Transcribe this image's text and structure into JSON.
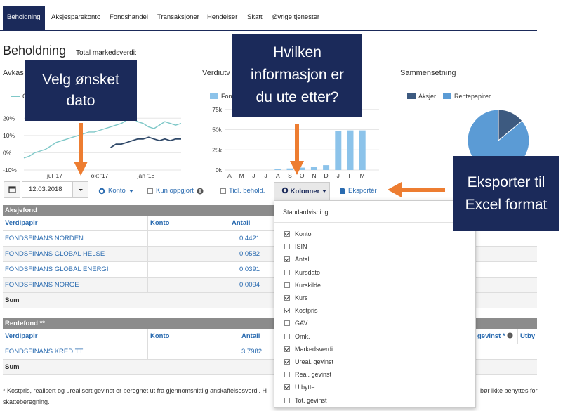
{
  "nav": {
    "tabs": [
      "Beholdning",
      "Aksjesparekonto",
      "Fondshandel",
      "Transaksjoner",
      "Hendelser",
      "Skatt",
      "Øvrige tjenester"
    ]
  },
  "page": {
    "title": "Beholdning",
    "subtitle": "Total markedsverdi:"
  },
  "sections": {
    "avkastning": "Avkas",
    "verdiutvikling": "Verdiutv",
    "sammensetning": "Sammensetning"
  },
  "legends": {
    "line_chart_partial": "O",
    "bar_chart_partial": "Fond",
    "pie_aksjer": "Aksjer",
    "pie_rente": "Rentepapirer"
  },
  "chart_data": [
    {
      "type": "line",
      "y_ticks": [
        "20%",
        "10%",
        "0%",
        "-10%"
      ],
      "x_ticks": [
        "jul '17",
        "okt '17",
        "jan '18"
      ],
      "ylim": [
        -10,
        25
      ],
      "series": [
        {
          "color": "#7fc8c8",
          "values": [
            -3,
            -2,
            0,
            1,
            2,
            4,
            6,
            7,
            8,
            9,
            10,
            11,
            12,
            12,
            13,
            14,
            15,
            16,
            17,
            19,
            20,
            18,
            17,
            15,
            14,
            16,
            18,
            17,
            16,
            17
          ]
        },
        {
          "color": "#2f4868",
          "values": [
            null,
            null,
            null,
            null,
            null,
            null,
            null,
            null,
            null,
            null,
            null,
            null,
            null,
            null,
            null,
            null,
            3,
            5,
            5,
            6,
            7,
            8,
            8,
            9,
            8,
            7,
            8,
            7,
            8,
            8
          ]
        }
      ]
    },
    {
      "type": "bar",
      "categories": [
        "A",
        "M",
        "J",
        "J",
        "A",
        "S",
        "O",
        "N",
        "D",
        "J",
        "F",
        "M"
      ],
      "values": [
        0,
        0,
        0,
        0,
        1,
        2,
        3,
        4,
        6,
        48,
        49,
        49
      ],
      "y_ticks": [
        "75k",
        "50k",
        "25k",
        "0k"
      ],
      "ylim": [
        0,
        80
      ],
      "color": "#8cc3ea"
    },
    {
      "type": "pie",
      "slices": [
        {
          "label": "Aksjer",
          "value": 14,
          "color": "#3d5a80"
        },
        {
          "label": "Rentepapirer",
          "value": 86,
          "color": "#5b9bd5"
        }
      ]
    }
  ],
  "toolbar": {
    "date_value": "12.03.2018",
    "konto": "Konto",
    "kun_oppgjort": "Kun oppgjort",
    "tidl_behold": "Tidl. behold.",
    "kolonner": "Kolonner",
    "eksporter": "Eksportér"
  },
  "table_aksjefond": {
    "title": "Aksjefond",
    "columns": [
      "Verdipapir",
      "Konto",
      "Antall"
    ],
    "rows": [
      {
        "name": "FONDSFINANS NORDEN",
        "antall": "0,4421"
      },
      {
        "name": "FONDSFINANS GLOBAL HELSE",
        "antall": "0,0582"
      },
      {
        "name": "FONDSFINANS GLOBAL ENERGI",
        "antall": "0,0391"
      },
      {
        "name": "FONDSFINANS NORGE",
        "antall": "0,0094"
      }
    ],
    "sum": "Sum"
  },
  "table_rentefond": {
    "title": "Rentefond **",
    "columns": [
      "Verdipapir",
      "Konto",
      "Antall"
    ],
    "extra_cols": [
      "gevinst *",
      "Utby"
    ],
    "rows": [
      {
        "name": "FONDSFINANS KREDITT",
        "antall": "3,7982"
      }
    ],
    "sum": "Sum"
  },
  "dropdown": {
    "header": "Standardvisning",
    "items": [
      {
        "label": "Konto",
        "checked": true
      },
      {
        "label": "ISIN",
        "checked": false
      },
      {
        "label": "Antall",
        "checked": true
      },
      {
        "label": "Kursdato",
        "checked": false
      },
      {
        "label": "Kurskilde",
        "checked": false
      },
      {
        "label": "Kurs",
        "checked": true
      },
      {
        "label": "Kostpris",
        "checked": true
      },
      {
        "label": "GAV",
        "checked": false
      },
      {
        "label": "Omk.",
        "checked": false
      },
      {
        "label": "Markedsverdi",
        "checked": true
      },
      {
        "label": "Ureal. gevinst",
        "checked": true
      },
      {
        "label": "Real. gevinst",
        "checked": false
      },
      {
        "label": "Utbytte",
        "checked": true
      },
      {
        "label": "Tot. gevinst",
        "checked": false
      }
    ]
  },
  "footnote": {
    "left": "* Kostpris, realisert og urealisert gevinst er beregnet ut fra gjennomsnittlig anskaffelsesverdi. H",
    "right": "bør ikke benyttes for",
    "line2": "skatteberegning."
  },
  "callouts": {
    "dato": "Velg ønsket dato",
    "info": "Hvilken informasjon er du ute etter?",
    "excel": "Eksporter til Excel format"
  },
  "colors": {
    "navy": "#1b2a5a",
    "arrow": "#ed7d31",
    "link": "#2a6bb0"
  }
}
